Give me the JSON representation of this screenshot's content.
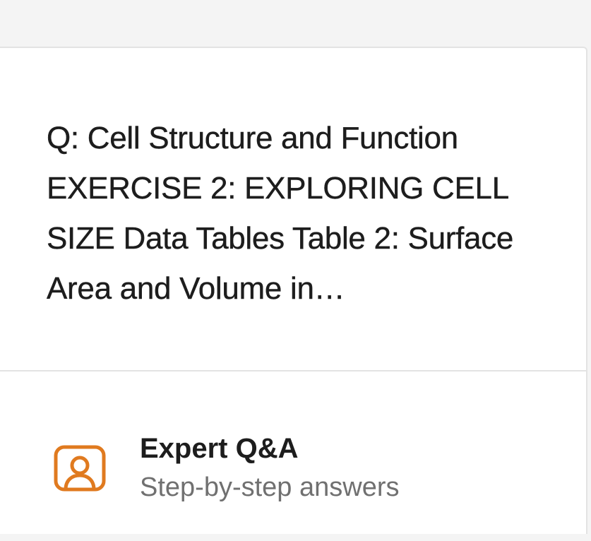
{
  "question": {
    "text": "Q: Cell Structure and Function EXERCISE 2: EXPLORING CELL SIZE Data Tables Table 2: Surface Area and Volume in…"
  },
  "feature": {
    "icon": "expert-person-icon",
    "title": "Expert Q&A",
    "subtitle": "Step-by-step answers",
    "accent_color": "#e07a1f"
  }
}
